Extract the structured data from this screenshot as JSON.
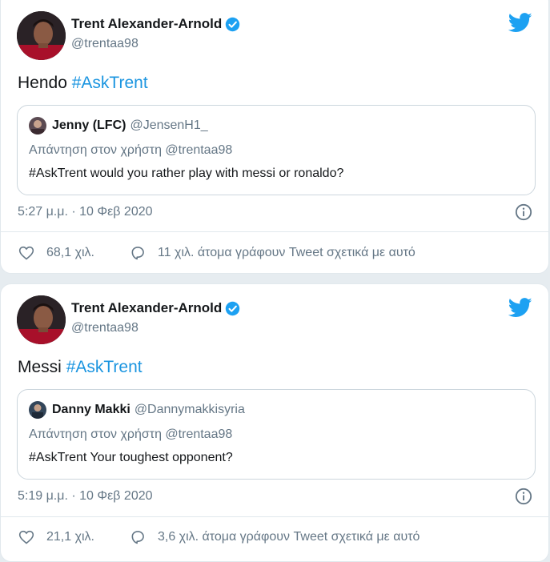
{
  "colors": {
    "accent": "#1b95e0",
    "muted": "#657786",
    "text": "#14171a"
  },
  "tweets": [
    {
      "author": {
        "name": "Trent Alexander-Arnold",
        "handle": "@trentaa98",
        "verified": true
      },
      "text_plain": "Hendo",
      "hashtag": "#AskTrent",
      "quoted": {
        "name": "Jenny (LFC)",
        "handle": "@JensenH1_",
        "reply_to": "Απάντηση στον χρήστη @trentaa98",
        "text": "#AskTrent would you rather play with messi or ronaldo?"
      },
      "timestamp": "5:27 μ.μ. · 10 Φεβ 2020",
      "likes": "68,1 χιλ.",
      "talking": "11 χιλ. άτομα γράφουν Tweet σχετικά με αυτό"
    },
    {
      "author": {
        "name": "Trent Alexander-Arnold",
        "handle": "@trentaa98",
        "verified": true
      },
      "text_plain": "Messi",
      "hashtag": "#AskTrent",
      "quoted": {
        "name": "Danny Makki",
        "handle": "@Dannymakkisyria",
        "reply_to": "Απάντηση στον χρήστη @trentaa98",
        "text": "#AskTrent Your toughest opponent?"
      },
      "timestamp": "5:19 μ.μ. · 10 Φεβ 2020",
      "likes": "21,1 χιλ.",
      "talking": "3,6 χιλ. άτομα γράφουν Tweet σχετικά με αυτό"
    }
  ]
}
